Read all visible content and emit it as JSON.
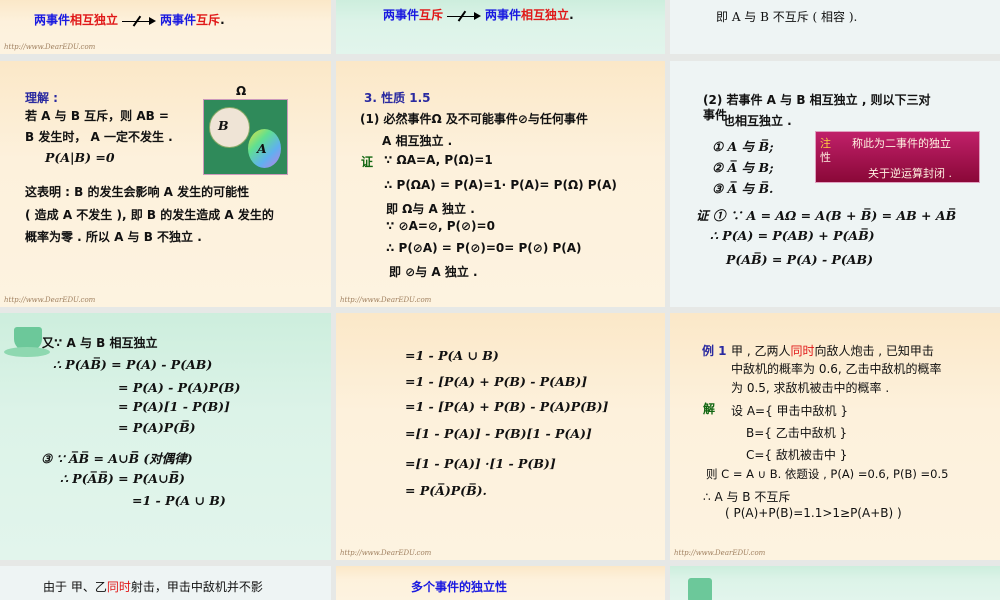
{
  "s_top1": {
    "p1": "两事件",
    "p2": "相互独立",
    "p3": "两事件",
    "p4": "互斥",
    "end": ".",
    "url": "http://www.DearEDU.com"
  },
  "s_top2": {
    "p1": "两事件",
    "p2": "互斥",
    "p3": "两事件",
    "p4": "相互独立",
    "end": "."
  },
  "s_top3": {
    "text": "即  A 与 B  不互斥 ( 相容 )."
  },
  "s_lijie": {
    "title": "理解 :",
    "l1": "若 A 与 B 互斥，则   AB =",
    "l2": "B 发生时， A 一定不发生 .",
    "l3": "P(A|B) =0",
    "omega": "Ω",
    "vb": "B",
    "va": "A",
    "l4": "这表明 : B 的发生会影响   A 发生的可能性",
    "l5": "( 造成 A 不发生 ), 即 B 的发生造成   A 发生的",
    "l6": "概率为零 . 所以 A 与 B 不独立 .",
    "url": "http://www.DearEDU.com"
  },
  "s_prop": {
    "title": "3. 性质 1.5",
    "l1": "(1)  必然事件Ω  及不可能事件⊘与任何事件",
    "l2": "A 相互独立 .",
    "zheng": "证",
    "l3": "∵   ΩA=A,  P(Ω)=1",
    "l4": "∴  P(ΩA) = P(A)=1· P(A)= P(Ω) P(A)",
    "l5": "即  Ω与 A 独立 .",
    "l6": "∵   ⊘A=⊘,  P(⊘)=0",
    "l7": "∴  P(⊘A) = P(⊘)=0= P(⊘) P(A)",
    "l8": "即  ⊘与 A 独立 .",
    "url": "http://www.DearEDU.com"
  },
  "s_prop2": {
    "l1": "(2)  若事件 A 与 B 相互独立 , 则以下三对",
    "l2a": "事件",
    "l2": "也相互独立 .",
    "i1": "①   A 与 B̅;",
    "i2": "②   A̅ 与 B;",
    "i3": "③   A̅ 与 B̅.",
    "note1": "注",
    "note2": "称此为二事件的独立",
    "note3": "性",
    "note4": "关于逆运算封闭 .",
    "p1": "证 ① ∵ A = AΩ = A(B + B̅) = AB + AB̅",
    "p2": "∴    P(A) = P(AB) + P(AB̅)",
    "p3": "P(AB̅) = P(A) -  P(AB)"
  },
  "s_cont": {
    "l1": "又∵      A 与 B 相互独立",
    "l2": "∴    P(AB̅) = P(A) -  P(AB)",
    "l3": "= P(A) -  P(A)P(B)",
    "l4": "= P(A)[1 -  P(B)]",
    "l5": "= P(A)P(B̅)",
    "l6": "③ ∵ A̅B̅ = A∪B̅̅̅  (对偶律)",
    "l7": "∴    P(A̅B̅) = P(A∪B̅̅̅)",
    "l8": "=1 -  P(A ∪ B)"
  },
  "s_cont2": {
    "l1": "=1 -  P(A ∪ B)",
    "l2": "=1 -  [P(A) + P(B) -  P(AB)]",
    "l3": "=1 -  [P(A) + P(B) -  P(A)P(B)]",
    "l4": "=[1 -  P(A)] -  P(B)[1 -  P(A)]",
    "l5": "=[1 -  P(A)] ·[1 -  P(B)]",
    "l6": "= P(A̅)P(B̅).",
    "url": "http://www.DearEDU.com"
  },
  "s_ex": {
    "tag": "例 1",
    "l1a": "甲 , 乙两人",
    "l1b": "同时",
    "l1c": "向敌人炮击 , 已知甲击",
    "l2": "中敌机的概率为 0.6,  乙击中敌机的概率",
    "l3": "为 0.5,  求敌机被击中的概率 .",
    "jie": "解",
    "l4": "设   A={  甲击中敌机    }",
    "l5": "B={  乙击中敌机    }",
    "l6": "C={ 敌机被击中    }",
    "l7": "则    C = A ∪ B.    依题设 , P(A) =0.6,    P(B) =0.5",
    "l8": "∴ A 与 B 不互斥",
    "l9": "(  P(A)+P(B)=1.1>1≥P(A+B)  )",
    "url": "http://www.DearEDU.com"
  },
  "s_bot1": {
    "a": "由于  甲、乙",
    "b": "同时",
    "c": "射击，甲击中敌机并不影"
  },
  "s_bot2": {
    "title": "多个事件的独立性"
  }
}
